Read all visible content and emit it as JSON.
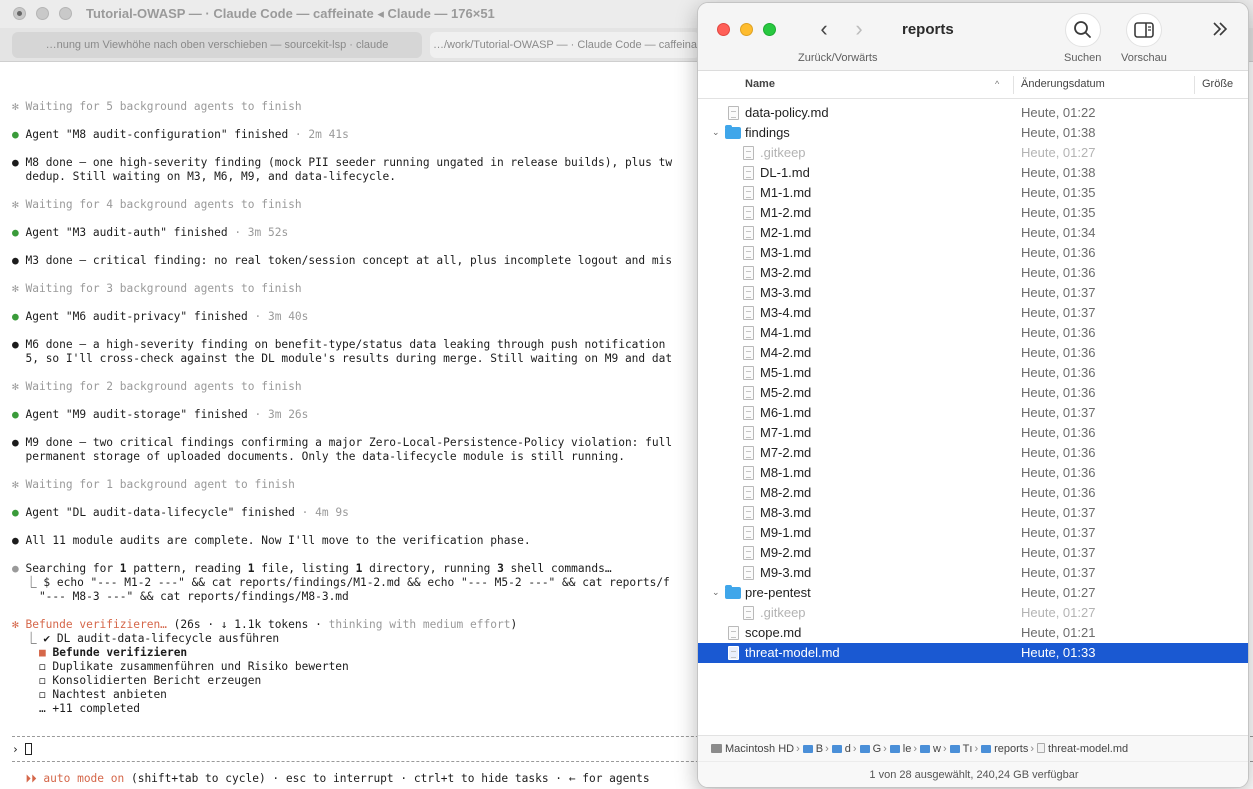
{
  "terminal": {
    "title": "Tutorial-OWASP — · Claude Code — caffeinate ◂ Claude — 176×51",
    "tabs": [
      {
        "label": "…nung um Viewhöhe nach oben verschieben — sourcekit-lsp · claude"
      },
      {
        "label": "…/work/Tutorial-OWASP — · Claude Code — caffeina"
      }
    ],
    "lines": {
      "w5": "✻ Waiting for 5 background agents to finish",
      "m8_agent": "Agent \"M8 audit-configuration\" finished",
      "m8_time": " · 2m 41s",
      "m8_done_1": "M8 done — one high-severity finding (mock PII seeder running ungated in release builds), plus tw",
      "m8_done_2": "dedup. Still waiting on M3, M6, M9, and data-lifecycle.",
      "w4": "✻ Waiting for 4 background agents to finish",
      "m3_agent": "Agent \"M3 audit-auth\" finished",
      "m3_time": " · 3m 52s",
      "m3_done_1": "M3 done — critical finding: no real token/session concept at all, plus incomplete logout and mis",
      "w3": "✻ Waiting for 3 background agents to finish",
      "m6_agent": "Agent \"M6 audit-privacy\" finished",
      "m6_time": " · 3m 40s",
      "m6_done_1": "M6 done — a high-severity finding on benefit-type/status data leaking through push notification",
      "m6_done_2": "5, so I'll cross-check against the DL module's results during merge. Still waiting on M9 and dat",
      "w2": "✻ Waiting for 2 background agents to finish",
      "m9_agent": "Agent \"M9 audit-storage\" finished",
      "m9_time": " · 3m 26s",
      "m9_done_1": "M9 done — two critical findings confirming a major Zero-Local-Persistence-Policy violation: full",
      "m9_done_2": "permanent storage of uploaded documents. Only the data-lifecycle module is still running.",
      "w1": "✻ Waiting for 1 background agent to finish",
      "dl_agent": "Agent \"DL audit-data-lifecycle\" finished",
      "dl_time": " · 4m 9s",
      "all_done": "All 11 module audits are complete. Now I'll move to the verification phase.",
      "search_1": "Searching for ",
      "search_n1": "1",
      "search_2": " pattern, reading ",
      "search_n2": "1",
      "search_3": " file, listing ",
      "search_n3": "1",
      "search_4": " directory, running ",
      "search_n4": "3",
      "search_5": " shell commands…",
      "cmd_1": "  ⎿ $ echo \"--- M1-2 ---\" && cat reports/findings/M1-2.md && echo \"--- M5-2 ---\" && cat reports/f",
      "cmd_2": "    \"--- M8-3 ---\" && cat reports/findings/M8-3.md",
      "status_main": "✻ Befunde verifizieren… ",
      "status_meta": "(26s · ↓ 1.1k tokens · ",
      "status_think": "thinking with medium effort",
      "status_close": ")",
      "task_1": "  ⎿ ✔ DL audit-data-lifecycle ausführen",
      "task_2": "Befunde verifizieren",
      "task_3": "    ◻ Duplikate zusammenführen und Risiko bewerten",
      "task_4": "    ◻ Konsolidierten Bericht erzeugen",
      "task_5": "    ◻ Nachtest anbieten",
      "task_6": "    … +11 completed",
      "prompt": "› ",
      "footer_arrows": "⏵⏵ auto mode on",
      "footer_rest": " (shift+tab to cycle) · esc to interrupt · ctrl+t to hide tasks · ← for agents"
    }
  },
  "finder": {
    "title": "reports",
    "nav_label": "Zurück/Vorwärts",
    "search_label": "Suchen",
    "preview_label": "Vorschau",
    "columns": {
      "name": "Name",
      "date": "Änderungsdatum",
      "size": "Größe"
    },
    "rows": [
      {
        "name": "data-policy.md",
        "date": "Heute, 01:22",
        "kind": "file",
        "depth": 0
      },
      {
        "name": "findings",
        "date": "Heute, 01:38",
        "kind": "folder",
        "depth": 0
      },
      {
        "name": ".gitkeep",
        "date": "Heute, 01:27",
        "kind": "file",
        "depth": 1,
        "dim": true
      },
      {
        "name": "DL-1.md",
        "date": "Heute, 01:38",
        "kind": "file",
        "depth": 1
      },
      {
        "name": "M1-1.md",
        "date": "Heute, 01:35",
        "kind": "file",
        "depth": 1
      },
      {
        "name": "M1-2.md",
        "date": "Heute, 01:35",
        "kind": "file",
        "depth": 1
      },
      {
        "name": "M2-1.md",
        "date": "Heute, 01:34",
        "kind": "file",
        "depth": 1
      },
      {
        "name": "M3-1.md",
        "date": "Heute, 01:36",
        "kind": "file",
        "depth": 1
      },
      {
        "name": "M3-2.md",
        "date": "Heute, 01:36",
        "kind": "file",
        "depth": 1
      },
      {
        "name": "M3-3.md",
        "date": "Heute, 01:37",
        "kind": "file",
        "depth": 1
      },
      {
        "name": "M3-4.md",
        "date": "Heute, 01:37",
        "kind": "file",
        "depth": 1
      },
      {
        "name": "M4-1.md",
        "date": "Heute, 01:36",
        "kind": "file",
        "depth": 1
      },
      {
        "name": "M4-2.md",
        "date": "Heute, 01:36",
        "kind": "file",
        "depth": 1
      },
      {
        "name": "M5-1.md",
        "date": "Heute, 01:36",
        "kind": "file",
        "depth": 1
      },
      {
        "name": "M5-2.md",
        "date": "Heute, 01:36",
        "kind": "file",
        "depth": 1
      },
      {
        "name": "M6-1.md",
        "date": "Heute, 01:37",
        "kind": "file",
        "depth": 1
      },
      {
        "name": "M7-1.md",
        "date": "Heute, 01:36",
        "kind": "file",
        "depth": 1
      },
      {
        "name": "M7-2.md",
        "date": "Heute, 01:36",
        "kind": "file",
        "depth": 1
      },
      {
        "name": "M8-1.md",
        "date": "Heute, 01:36",
        "kind": "file",
        "depth": 1
      },
      {
        "name": "M8-2.md",
        "date": "Heute, 01:36",
        "kind": "file",
        "depth": 1
      },
      {
        "name": "M8-3.md",
        "date": "Heute, 01:37",
        "kind": "file",
        "depth": 1
      },
      {
        "name": "M9-1.md",
        "date": "Heute, 01:37",
        "kind": "file",
        "depth": 1
      },
      {
        "name": "M9-2.md",
        "date": "Heute, 01:37",
        "kind": "file",
        "depth": 1
      },
      {
        "name": "M9-3.md",
        "date": "Heute, 01:37",
        "kind": "file",
        "depth": 1
      },
      {
        "name": "pre-pentest",
        "date": "Heute, 01:27",
        "kind": "folder",
        "depth": 0
      },
      {
        "name": ".gitkeep",
        "date": "Heute, 01:27",
        "kind": "file",
        "depth": 1,
        "dim": true
      },
      {
        "name": "scope.md",
        "date": "Heute, 01:21",
        "kind": "file",
        "depth": 0
      },
      {
        "name": "threat-model.md",
        "date": "Heute, 01:33",
        "kind": "file",
        "depth": 0,
        "selected": true
      }
    ],
    "path": [
      {
        "label": "Macintosh HD",
        "kind": "hd"
      },
      {
        "label": "B",
        "kind": "folder"
      },
      {
        "label": "d",
        "kind": "folder"
      },
      {
        "label": "G",
        "kind": "folder"
      },
      {
        "label": "le",
        "kind": "folder"
      },
      {
        "label": "w",
        "kind": "folder"
      },
      {
        "label": "Tı",
        "kind": "folder"
      },
      {
        "label": "reports",
        "kind": "folder"
      },
      {
        "label": "threat-model.md",
        "kind": "doc"
      }
    ],
    "status": "1 von 28 ausgewählt, 240,24 GB verfügbar",
    "accent": "#1a59d2",
    "folder_color": "#3fa6ea"
  }
}
